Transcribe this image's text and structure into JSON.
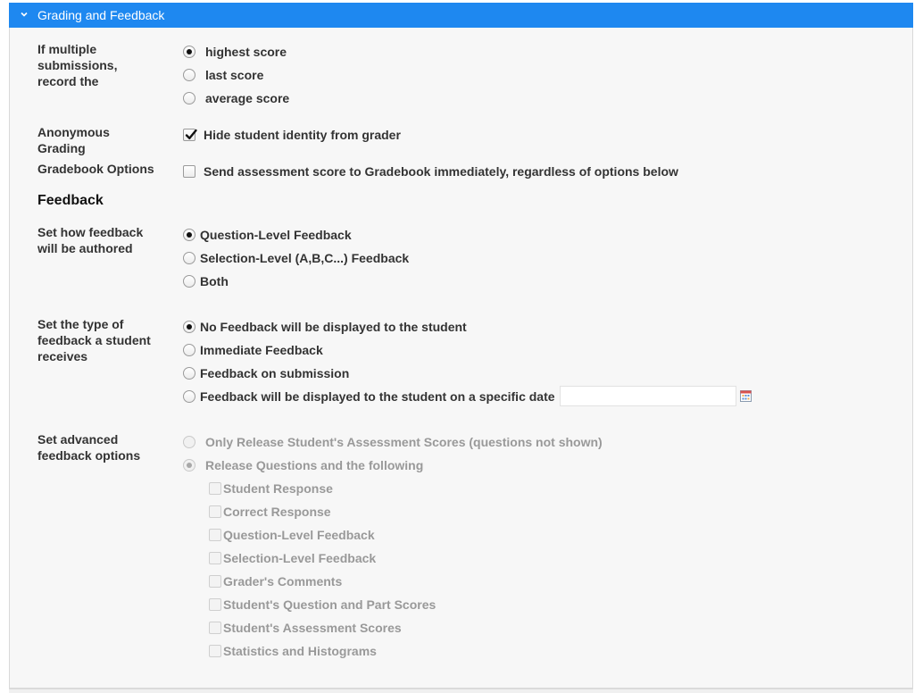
{
  "header": {
    "title": "Grading and Feedback"
  },
  "submissions": {
    "label": "If multiple submissions, record the",
    "options": [
      "highest score",
      "last score",
      "average score"
    ],
    "selected": 0
  },
  "anonymous": {
    "label": "Anonymous Grading",
    "checkbox_label": "Hide student identity from grader",
    "checked": true
  },
  "gradebook": {
    "label": "Gradebook Options",
    "checkbox_label": "Send assessment score to Gradebook immediately, regardless of options below",
    "checked": false
  },
  "feedback": {
    "heading": "Feedback",
    "authored": {
      "label": "Set how feedback will be authored",
      "options": [
        "Question-Level Feedback",
        "Selection-Level (A,B,C...) Feedback",
        "Both"
      ],
      "selected": 0
    },
    "type": {
      "label": "Set the type of feedback a student receives",
      "options": [
        "No Feedback will be displayed to the student",
        "Immediate Feedback",
        "Feedback on submission",
        "Feedback will be displayed to the student on a specific date"
      ],
      "selected": 0,
      "date_value": ""
    },
    "advanced": {
      "label": "Set advanced feedback options",
      "options": [
        "Only Release Student's Assessment Scores (questions not shown)",
        "Release Questions and the following"
      ],
      "selected": 1,
      "disabled": true,
      "sub_options": [
        "Student Response",
        "Correct Response",
        "Question-Level Feedback",
        "Selection-Level Feedback",
        "Grader's Comments",
        "Student's Question and Part Scores",
        "Student's Assessment Scores",
        "Statistics and Histograms"
      ]
    }
  },
  "colors": {
    "header_bg": "#1e88f0",
    "panel_bg": "#f7f7f7",
    "disabled_text": "#999999"
  },
  "icons": {
    "header": "chevron-down-icon",
    "date": "calendar-icon",
    "check": "checkmark-icon"
  }
}
